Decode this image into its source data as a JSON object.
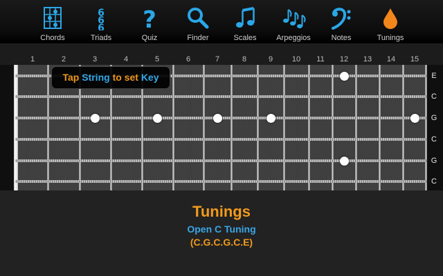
{
  "toolbar": {
    "items": [
      {
        "label": "Chords",
        "icon": "chord-diagram-icon"
      },
      {
        "label": "Triads",
        "icon": "triad-icon"
      },
      {
        "label": "Quiz",
        "icon": "question-mark-icon"
      },
      {
        "label": "Finder",
        "icon": "magnifier-icon"
      },
      {
        "label": "Scales",
        "icon": "music-notes-icon"
      },
      {
        "label": "Arpeggios",
        "icon": "arpeggio-notes-icon"
      },
      {
        "label": "Notes",
        "icon": "bass-clef-icon"
      },
      {
        "label": "Tunings",
        "icon": "drop-icon"
      }
    ],
    "icon_color": "#2aa7e8",
    "active_icon_color": "#f2861b"
  },
  "fretboard": {
    "fret_numbers": [
      "1",
      "2",
      "3",
      "4",
      "5",
      "6",
      "7",
      "8",
      "9",
      "10",
      "11",
      "12",
      "13",
      "14",
      "15"
    ],
    "strings": [
      "E",
      "C",
      "G",
      "C",
      "G",
      "C"
    ],
    "dots": [
      {
        "string": 1,
        "fret": 12
      },
      {
        "string": 3,
        "fret": 3
      },
      {
        "string": 3,
        "fret": 5
      },
      {
        "string": 3,
        "fret": 7
      },
      {
        "string": 3,
        "fret": 9
      },
      {
        "string": 3,
        "fret": 15
      },
      {
        "string": 5,
        "fret": 12
      }
    ]
  },
  "hint": {
    "part1": "Tap",
    "part2": "String",
    "part3": "to set",
    "part4": "Key"
  },
  "info": {
    "title": "Tunings",
    "tuning_name": "Open C Tuning",
    "tuning_notes": "(C.G.C.G.C.E)"
  }
}
